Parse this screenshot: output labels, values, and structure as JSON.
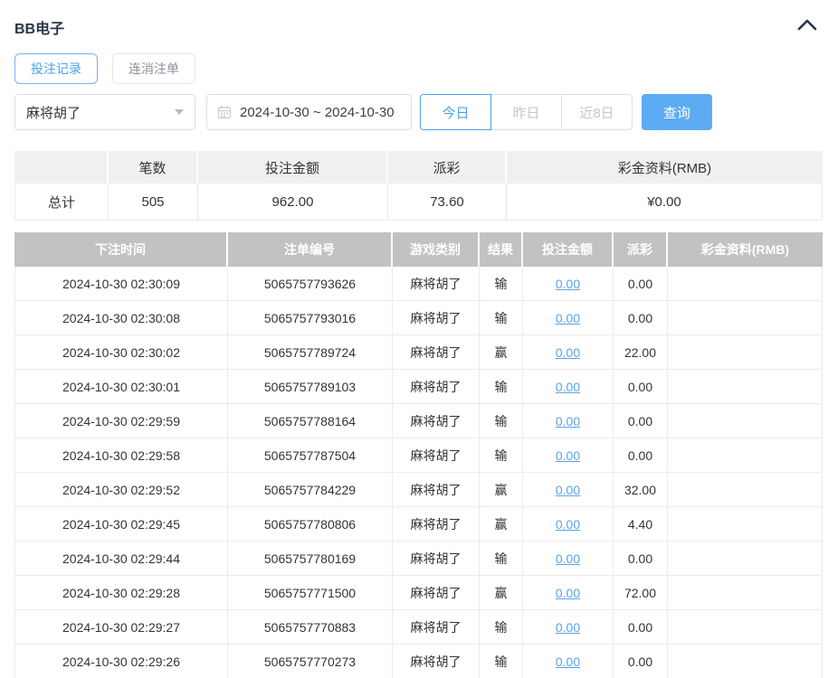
{
  "panel": {
    "title": "BB电子",
    "collapse_icon": "chevron-up"
  },
  "tabs": [
    {
      "label": "投注记录",
      "active": true
    },
    {
      "label": "连消注单",
      "active": false
    }
  ],
  "filters": {
    "game_select": {
      "value": "麻将胡了"
    },
    "date_range": {
      "value": "2024-10-30 ~ 2024-10-30",
      "icon": "calendar-icon"
    },
    "quick_ranges": [
      {
        "label": "今日",
        "active": true
      },
      {
        "label": "昨日",
        "active": false
      },
      {
        "label": "近8日",
        "active": false
      }
    ],
    "query_button": "查询"
  },
  "summary": {
    "columns": [
      "",
      "笔数",
      "投注金额",
      "派彩",
      "彩金资料(RMB)"
    ],
    "row": [
      "总计",
      "505",
      "962.00",
      "73.60",
      "¥0.00"
    ]
  },
  "bets_table": {
    "columns": [
      "下注时间",
      "注单编号",
      "游戏类别",
      "结果",
      "投注金额",
      "派彩",
      "彩金资料(RMB)"
    ],
    "rows": [
      [
        "2024-10-30 02:30:09",
        "5065757793626",
        "麻将胡了",
        "输",
        "0.00",
        "0.00",
        ""
      ],
      [
        "2024-10-30 02:30:08",
        "5065757793016",
        "麻将胡了",
        "输",
        "0.00",
        "0.00",
        ""
      ],
      [
        "2024-10-30 02:30:02",
        "5065757789724",
        "麻将胡了",
        "赢",
        "0.00",
        "22.00",
        ""
      ],
      [
        "2024-10-30 02:30:01",
        "5065757789103",
        "麻将胡了",
        "输",
        "0.00",
        "0.00",
        ""
      ],
      [
        "2024-10-30 02:29:59",
        "5065757788164",
        "麻将胡了",
        "输",
        "0.00",
        "0.00",
        ""
      ],
      [
        "2024-10-30 02:29:58",
        "5065757787504",
        "麻将胡了",
        "输",
        "0.00",
        "0.00",
        ""
      ],
      [
        "2024-10-30 02:29:52",
        "5065757784229",
        "麻将胡了",
        "赢",
        "0.00",
        "32.00",
        ""
      ],
      [
        "2024-10-30 02:29:45",
        "5065757780806",
        "麻将胡了",
        "赢",
        "0.00",
        "4.40",
        ""
      ],
      [
        "2024-10-30 02:29:44",
        "5065757780169",
        "麻将胡了",
        "输",
        "0.00",
        "0.00",
        ""
      ],
      [
        "2024-10-30 02:29:28",
        "5065757771500",
        "麻将胡了",
        "赢",
        "0.00",
        "72.00",
        ""
      ],
      [
        "2024-10-30 02:29:27",
        "5065757770883",
        "麻将胡了",
        "输",
        "0.00",
        "0.00",
        ""
      ],
      [
        "2024-10-30 02:29:26",
        "5065757770273",
        "麻将胡了",
        "输",
        "0.00",
        "0.00",
        ""
      ]
    ]
  },
  "colors": {
    "accent_blue": "#4ba2f0",
    "query_button_bg": "#5dabf2",
    "link_blue": "#57a3ec",
    "table_header_bg": "#c2c2c2",
    "summary_header_bg": "#f0f0f0",
    "header_text": "#2b3547"
  }
}
